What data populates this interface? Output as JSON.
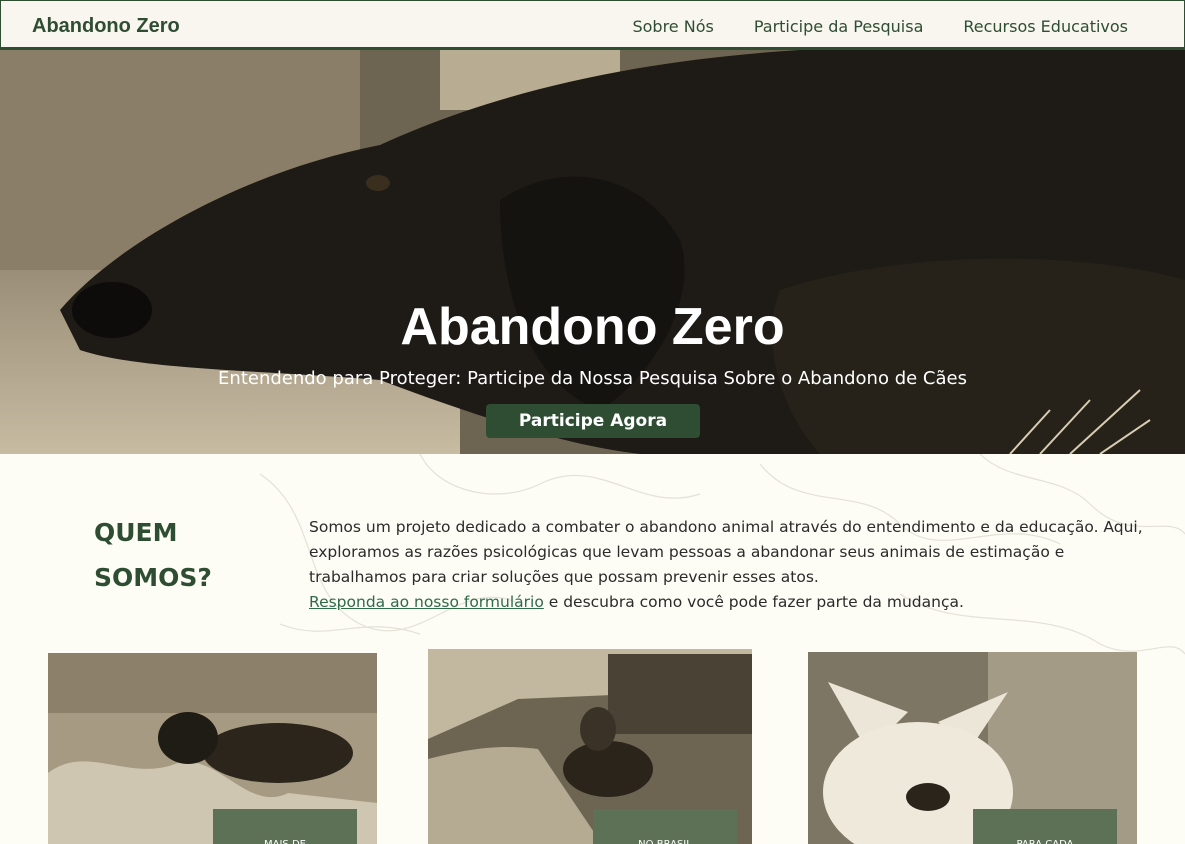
{
  "nav": {
    "brand": "Abandono Zero",
    "links": [
      "Sobre Nós",
      "Participe da Pesquisa",
      "Recursos Educativos"
    ]
  },
  "hero": {
    "title": "Abandono Zero",
    "subtitle": "Entendendo para Proteger: Participe da Nossa Pesquisa Sobre o Abandono de Cães",
    "cta": "Participe Agora"
  },
  "about": {
    "title": "QUEM SOMOS?",
    "paragraph": "Somos um projeto dedicado a combater o abandono animal através do entendimento e da educação. Aqui, exploramos as razões psicológicas que levam pessoas a abandonar seus animais de estimação e trabalhamos para criar soluções que possam prevenir esses atos.",
    "link_text": "Responda ao nosso formulário",
    "after_link": " e descubra como você pode fazer parte da mudança."
  },
  "cards": [
    {
      "badge": "MAIS DE"
    },
    {
      "badge": "NO BRASIL"
    },
    {
      "badge": "PARA CADA"
    }
  ],
  "colors": {
    "primary": "#2f4d33",
    "background": "#fdfcf5",
    "badge": "#5c7156"
  }
}
